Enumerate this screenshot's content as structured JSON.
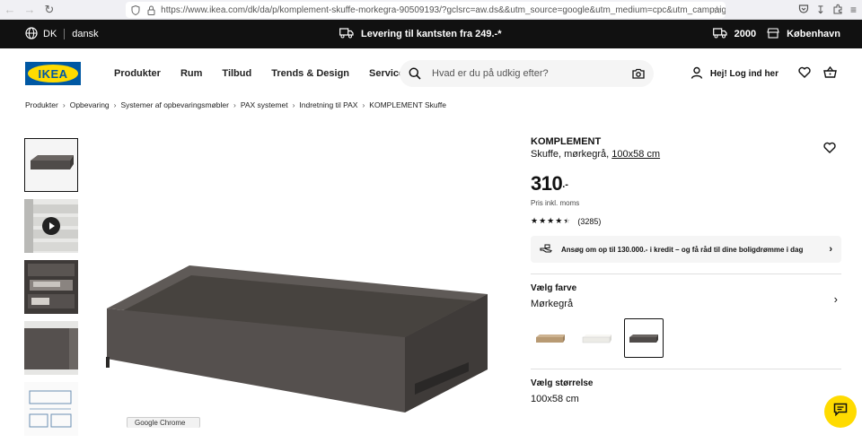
{
  "browser": {
    "url": "https://www.ikea.com/dk/da/p/komplement-skuffe-morkegra-90509193/?gclsrc=aw.ds&&utm_source=google&utm_medium=cpc&utm_campaign=H"
  },
  "topbar": {
    "country": "DK",
    "language": "dansk",
    "delivery_text": "Levering til kantsten fra 249.-*",
    "postcode": "2000",
    "store": "København"
  },
  "header": {
    "logo_text": "IKEA",
    "nav": [
      "Produkter",
      "Rum",
      "Tilbud",
      "Trends & Design",
      "Servicer"
    ],
    "search_placeholder": "Hvad er du på udkig efter?",
    "login_label": "Hej! Log ind her"
  },
  "breadcrumb": [
    "Produkter",
    "Opbevaring",
    "Systemer af opbevaringsmøbler",
    "PAX systemet",
    "Indretning til PAX",
    "KOMPLEMENT Skuffe"
  ],
  "product": {
    "name": "KOMPLEMENT",
    "desc_prefix": "Skuffe, mørkegrå,",
    "desc_size": "100x58 cm",
    "price": "310",
    "price_tail": ".-",
    "price_note": "Pris inkl. moms",
    "rating_value": 4.5,
    "review_count": "(3285)",
    "credit_text": "Ansøg om op til 130.000.- i kredit – og få råd til dine boligdrømme i dag",
    "color_title": "Vælg farve",
    "color_value": "Mørkegrå",
    "size_title": "Vælg størrelse",
    "size_value": "100x58 cm"
  },
  "swatch_colors": [
    "#b89a73",
    "#ecebe6",
    "#4f4b49"
  ],
  "tooltip": "Google Chrome",
  "colors": {
    "ikea_blue": "#0058a3",
    "ikea_yellow": "#ffdb00",
    "drawer": "#55504f"
  }
}
